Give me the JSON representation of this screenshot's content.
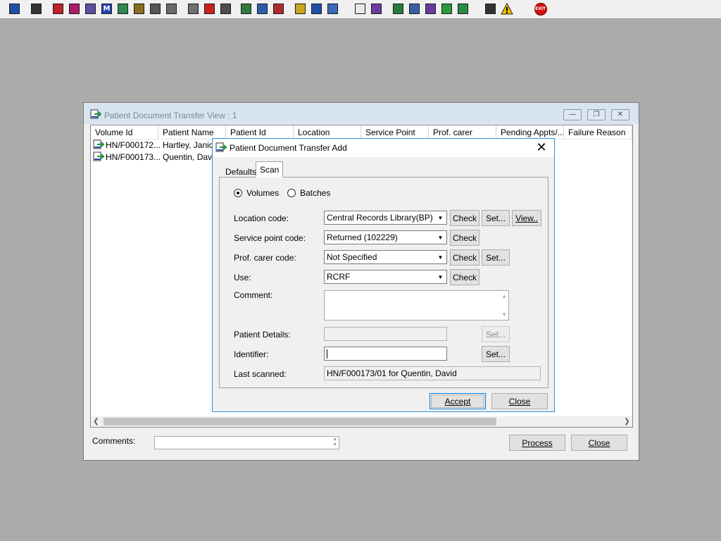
{
  "toolbar": {
    "buttons": [
      {
        "name": "user-icon",
        "color": "#1f4fa8"
      },
      {
        "name": "printer-icon",
        "color": "#333333"
      },
      {
        "name": "red-book-icon",
        "color": "#c0202a"
      },
      {
        "name": "edit-book-icon",
        "color": "#b01a6a"
      },
      {
        "name": "form-icon",
        "color": "#5a4fa0"
      },
      {
        "name": "letter-m-icon",
        "color": "#2740b5",
        "glyph": "M"
      },
      {
        "name": "clinician-icon",
        "color": "#2d8a4d"
      },
      {
        "name": "notes-icon",
        "color": "#8a6d1f"
      },
      {
        "name": "handshake-icon",
        "color": "#555555"
      },
      {
        "name": "handshake-alt-icon",
        "color": "#6a6a6a"
      },
      {
        "name": "note-pencil-icon",
        "color": "#707070"
      },
      {
        "name": "clock-icon",
        "color": "#cc2020"
      },
      {
        "name": "screen-icon",
        "color": "#4d4d4d"
      },
      {
        "name": "document-chart-icon",
        "color": "#2f7a3f"
      },
      {
        "name": "document-list-icon",
        "color": "#2c5ea8"
      },
      {
        "name": "time-report-icon",
        "color": "#b02c2c"
      },
      {
        "name": "yellow-notes-icon",
        "color": "#c9a81d"
      },
      {
        "name": "ambulance-icon",
        "color": "#1f4fa8"
      },
      {
        "name": "people-transfer-icon",
        "color": "#3c6bb5"
      },
      {
        "name": "blank-page-icon",
        "color": "#e8e8e8"
      },
      {
        "name": "bar-chart-icon",
        "color": "#6c3aa3"
      },
      {
        "name": "globe-icon",
        "color": "#2a7a3a"
      },
      {
        "name": "mail-list-icon",
        "color": "#3a5fa8"
      },
      {
        "name": "mail-check-icon",
        "color": "#6a3aa3"
      },
      {
        "name": "mail-green-icon",
        "color": "#2a9a3a"
      },
      {
        "name": "transfer-icon",
        "color": "#2a8a4a"
      },
      {
        "name": "swap-arrows-icon",
        "color": "#333333"
      },
      {
        "name": "warning-icon",
        "color": "#f2c200"
      },
      {
        "name": "exit-icon",
        "color": "#d01010",
        "glyph": "EXIT"
      }
    ]
  },
  "view_window": {
    "title": "Patient Document Transfer View : 1",
    "columns": [
      "Volume Id",
      "Patient Name",
      "Patient Id",
      "Location",
      "Service Point",
      "Prof. carer",
      "Pending Appts/...",
      "Failure Reason"
    ],
    "rows": [
      {
        "volume_id": "HN/F000172...",
        "patient_name": "Hartley, Janice"
      },
      {
        "volume_id": "HN/F000173...",
        "patient_name": "Quentin, David"
      }
    ],
    "comments_label": "Comments:",
    "comments_value": "",
    "process_label": "Process",
    "close_label": "Close"
  },
  "add_dialog": {
    "title": "Patient Document Transfer Add",
    "tabs": [
      "Defaults",
      "Scan"
    ],
    "active_tab": "Scan",
    "scan_mode": {
      "options": [
        "Volumes",
        "Batches"
      ],
      "selected": "Volumes"
    },
    "location_code": {
      "label": "Location code:",
      "value": "Central Records Library(BP)"
    },
    "service_point_code": {
      "label": "Service point code:",
      "value": "Returned (102229)"
    },
    "prof_carer_code": {
      "label": "Prof. carer code:",
      "value": "Not Specified"
    },
    "use": {
      "label": "Use:",
      "value": "RCRF"
    },
    "comment": {
      "label": "Comment:",
      "value": ""
    },
    "patient_details": {
      "label": "Patient Details:",
      "value": ""
    },
    "identifier": {
      "label": "Identifier:",
      "value": ""
    },
    "last_scanned": {
      "label": "Last scanned:",
      "value": "HN/F000173/01 for Quentin, David"
    },
    "check_label": "Check",
    "set_label": "Set...",
    "view_label": "View..",
    "accept_label": "Accept",
    "close_label": "Close"
  }
}
